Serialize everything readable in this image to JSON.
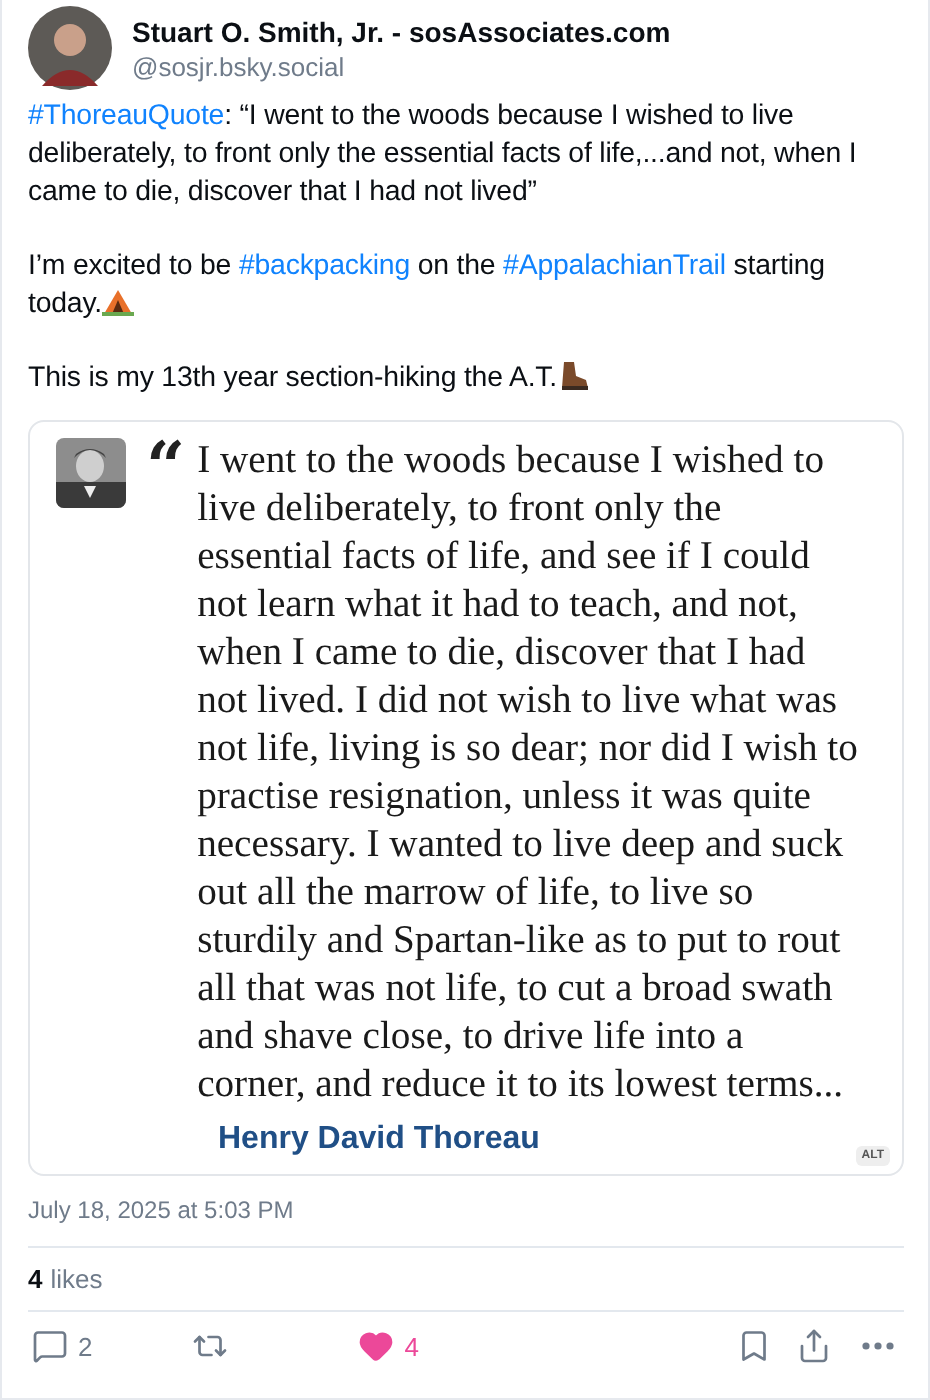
{
  "author": {
    "name": "Stuart O. Smith, Jr. - sosAssociates.com",
    "handle": "@sosjr.bsky.social"
  },
  "paragraphs": [
    {
      "segments": [
        {
          "kind": "tag",
          "text": "#ThoreauQuote"
        },
        {
          "kind": "plain",
          "text": ": “I went to the woods because I wished to live deliberately, to front only the essential facts of life,...and not, when I came to die, discover that I had not lived”"
        }
      ]
    },
    {
      "segments": [
        {
          "kind": "plain",
          "text": "I’m excited to be "
        },
        {
          "kind": "tag",
          "text": "#backpacking"
        },
        {
          "kind": "plain",
          "text": " on the "
        },
        {
          "kind": "tag",
          "text": "#AppalachianTrail"
        },
        {
          "kind": "plain",
          "text": " starting today."
        },
        {
          "kind": "tent"
        }
      ]
    },
    {
      "segments": [
        {
          "kind": "plain",
          "text": "This is my 13th year section-hiking the A.T."
        },
        {
          "kind": "boot"
        }
      ]
    }
  ],
  "image": {
    "mark": "“",
    "quote": "I went to the woods because I wished to live deliberately, to front only the essential facts of life, and see if I could not learn what it had to teach, and not, when I came to die, discover that I had not lived. I did not wish to live what was not life, living is so dear; nor did I wish to practise resignation, unless it was quite necessary. I wanted to live deep and suck out all the marrow of life, to live so sturdily and Spartan-like as to put to rout all that was not life, to cut a broad swath and shave close, to drive life into a corner, and reduce it to its lowest terms...",
    "attribution": "Henry David Thoreau",
    "alt_badge": "ALT"
  },
  "timestamp": "July 18, 2025 at 5:03 PM",
  "likes": {
    "count": "4",
    "label": "likes"
  },
  "actions": [
    {
      "kind": "reply",
      "count": "2",
      "on": false
    },
    {
      "kind": "repost",
      "on": false
    },
    {
      "kind": "like",
      "count": "4",
      "on": true
    },
    {
      "kind": "bookmark",
      "on": false
    },
    {
      "kind": "share",
      "on": false
    },
    {
      "kind": "more",
      "on": false
    }
  ]
}
